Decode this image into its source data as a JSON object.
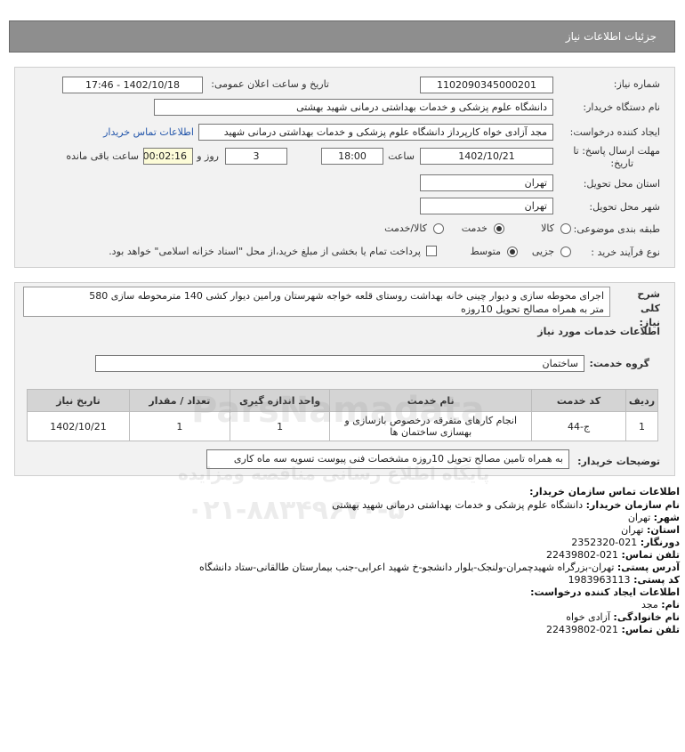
{
  "header": {
    "title": "جزئیات اطلاعات نیاز"
  },
  "form": {
    "need_number": {
      "label": "شماره نیاز:",
      "value": "1102090345000201"
    },
    "announce": {
      "label": "تاریخ و ساعت اعلان عمومی:",
      "value": "1402/10/18 - 17:46"
    },
    "buyer_org": {
      "label": "نام دستگاه خریدار:",
      "value": "دانشگاه علوم پزشکی و خدمات بهداشتی درمانی شهید بهشتی"
    },
    "creator": {
      "label": "ایجاد کننده درخواست:",
      "value": "مجد آزادی خواه کارپرداز دانشگاه علوم پزشکی و خدمات بهداشتی درمانی شهید",
      "link": "اطلاعات تماس خریدار"
    },
    "deadline": {
      "label_line1": "مهلت ارسال پاسخ: تا",
      "label_line2": "تاریخ:",
      "date": "1402/10/21",
      "time_label": "ساعت",
      "time": "18:00",
      "days": "3",
      "days_label": "روز و",
      "remaining": "00:02:16",
      "remaining_label": "ساعت باقی مانده"
    },
    "province": {
      "label": "استان محل تحویل:",
      "value": "تهران"
    },
    "city": {
      "label": "شهر محل تحویل:",
      "value": "تهران"
    },
    "category": {
      "label": "طبقه بندی موضوعی:",
      "options": [
        "کالا",
        "خدمت",
        "کالا/خدمت"
      ],
      "selected": "خدمت"
    },
    "process": {
      "label": "نوع فرآیند خرید :",
      "options": [
        "جزیی",
        "متوسط"
      ],
      "selected": "متوسط",
      "payment_note": "پرداخت تمام یا بخشی از مبلغ خرید،از محل \"اسناد خزانه اسلامی\" خواهد بود."
    }
  },
  "summary": {
    "label": "شرح کلی نیاز:",
    "text_line1": "اجرای محوطه سازی و دیوار چینی خانه بهداشت روستای قلعه خواجه شهرستان ورامین دیوار کشی 140 مترمحوطه سازی 580",
    "text_line2": "متر به همراه مصالح تحویل 10روزه"
  },
  "services": {
    "section_title": "اطلاعات خدمات مورد نیاز",
    "group_label": "گروه خدمت:",
    "group_value": "ساختمان",
    "table": {
      "headers": [
        "ردیف",
        "کد خدمت",
        "نام خدمت",
        "واحد اندازه گیری",
        "تعداد / مقدار",
        "تاریخ نیاز"
      ],
      "rows": [
        {
          "row": "1",
          "code": "ج-44",
          "name": "انجام کارهای متفرقه درخصوص بازسازی و بهسازی ساختمان ها",
          "unit": "1",
          "qty": "1",
          "date": "1402/10/21"
        }
      ]
    },
    "buyer_notes_label": "توضیحات خریدار:",
    "buyer_notes": "به همراه تامین مصالح تحویل 10روزه مشخصات فنی پیوست تسویه سه ماه کاری"
  },
  "contact": {
    "title": "اطلاعات تماس سازمان خریدار:",
    "org_label": "نام سازمان خریدار:",
    "org": "دانشگاه علوم پزشکی و خدمات بهداشتی درمانی شهید بهشتی",
    "city_label": "شهر:",
    "city": "تهران",
    "province_label": "استان:",
    "province": "تهران",
    "fax_label": "دورنگار:",
    "fax": "021-2352320",
    "phone_label": "تلفن تماس:",
    "phone": "021-22439802",
    "address_label": "آدرس پستی:",
    "address": "تهران-بزرگراه شهیدچمران-ولنجک-بلوار دانشجو-خ شهید اعرابی-جنب بیمارستان طالقانی-ستاد دانشگاه",
    "postal_label": "کد پستی:",
    "postal": "1983963113",
    "creator_title": "اطلاعات ایجاد کننده درخواست:",
    "first_name_label": "نام:",
    "first_name": "مجد",
    "last_name_label": "نام خانوادگی:",
    "last_name": "آزادی خواه",
    "creator_phone_label": "تلفن تماس:",
    "creator_phone": "021-22439802"
  },
  "watermark": {
    "brand": "ParsNamadata",
    "tagline": "پایگاه اطلاع رسانی مناقصه ومزایده",
    "phone": "۰۲۱-۸۸۳۴۹۶۷۰-۵"
  },
  "colors": {
    "header_bg": "#8e8e8e",
    "panel_bg": "#f2f2f2",
    "link": "#2255aa",
    "table_header": "#d4d4d4"
  }
}
